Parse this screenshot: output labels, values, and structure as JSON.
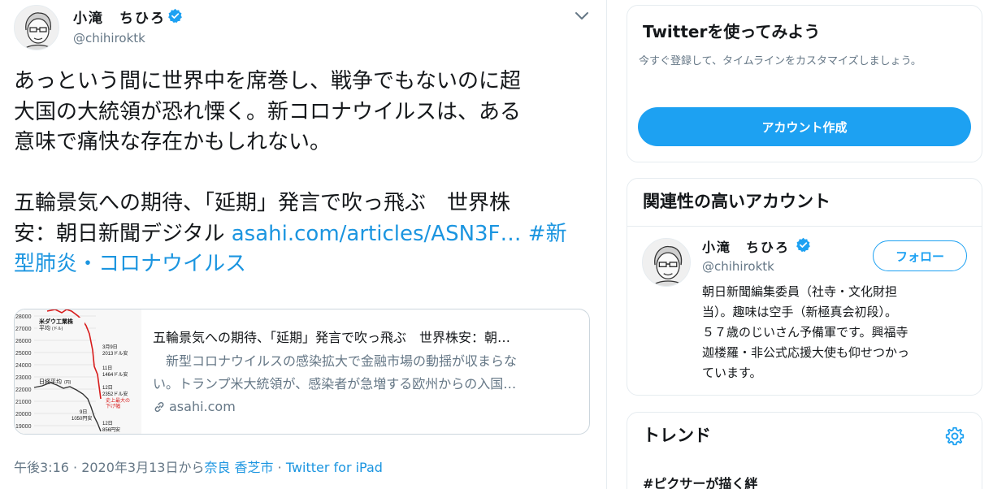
{
  "tweet": {
    "author_name": "小滝　ちひろ",
    "author_handle": "@chihiroktk",
    "text_lines": [
      "あっという間に世界中を席巻し、戦争でもないのに超",
      "大国の大統領が恐れ慄く。新コロナウイルスは、ある",
      "意味で痛快な存在かもしれない。"
    ],
    "text_line4_prefix": "五輪景気への期待、「延期」発言で吹っ飛ぶ　世界株",
    "text_line5_prefix": "安：朝日新聞デジタル ",
    "text_link": "asahi.com/articles/ASN3F…",
    "hashtag_part1": " #新",
    "hashtag_part2": "型肺炎・コロナウイルス",
    "card": {
      "title": "五輪景気への期待、「延期」発言で吹っ飛ぶ　世界株安：朝…",
      "desc_line1": "　新型コロナウイルスの感染拡大で金融市場の動揺が収まらな",
      "desc_line2": "い。トランプ米大統領が、感染者が急増する欧州からの入国…",
      "domain": "asahi.com",
      "thumb": {
        "y_labels": [
          "28000",
          "27000",
          "26000",
          "25000",
          "24000",
          "23000",
          "22000",
          "21000",
          "20000",
          "19000"
        ],
        "label_dow": "米ダウ工業株",
        "label_dow2": "平均",
        "label_dow_unit": "(ドル)",
        "label_nikkei": "日経平均",
        "label_nikkei_unit": "(円)",
        "ann_1_date": "3月9日",
        "ann_1_val": "2013ドル安",
        "ann_2_date": "11日",
        "ann_2_val": "1464ドル安",
        "ann_3_date": "12日",
        "ann_3_val": "2352ドル安",
        "ann_3_note1": "史上最大の",
        "ann_3_note2": "下げ幅",
        "ann_4_date": "9日",
        "ann_4_val": "1050円安",
        "ann_5_date": "12日",
        "ann_5_val": "856円安"
      }
    },
    "meta_time": "午後3:16 · 2020年3月13日から",
    "meta_place": "奈良 香芝市",
    "meta_sep": " · ",
    "meta_source": "Twitter for iPad"
  },
  "signup": {
    "title": "Twitterを使ってみよう",
    "desc": "今すぐ登録して、タイムラインをカスタマイズしましょう。",
    "button": "アカウント作成"
  },
  "related": {
    "title": "関連性の高いアカウント",
    "name": "小滝　ちひろ",
    "handle": "@chihiroktk",
    "follow": "フォロー",
    "bio_lines": [
      "朝日新聞編集委員（社寺・文化財担",
      "当）。趣味は空手（新極真会初段）。",
      "５７歳のじいさん予備軍です。興福寺",
      "迦楼羅・非公式応援大使も仰せつかっ",
      "ています。"
    ]
  },
  "trends": {
    "title": "トレンド",
    "items": [
      "#ピクサーが描く絆"
    ]
  },
  "colors": {
    "accent": "#1da1f2",
    "link": "#1b95e0",
    "muted": "#657786",
    "border": "#e6ecf0"
  }
}
